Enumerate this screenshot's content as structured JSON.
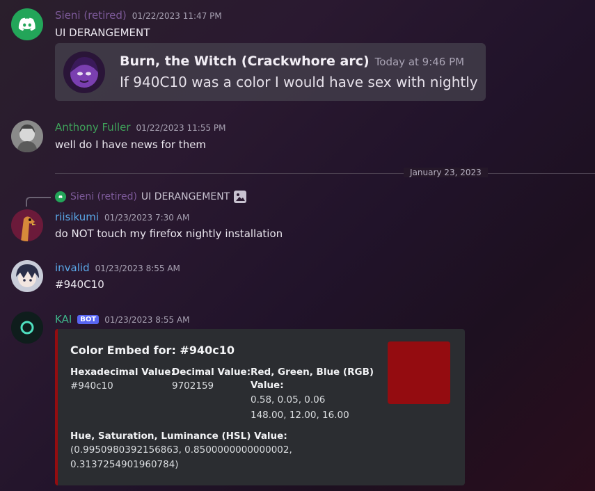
{
  "messages": [
    {
      "author": "Sieni (retired)",
      "author_color": "#7d5a9a",
      "timestamp": "01/22/2023 11:47 PM",
      "text": "UI DERANGEMENT",
      "avatar_icon": "discord-logo-icon",
      "embed": {
        "title": "Burn, the Witch (Crackwhore arc)",
        "time": "Today at 9:46 PM",
        "text": "If 940C10 was a color I would have sex with nightly"
      }
    },
    {
      "author": "Anthony Fuller",
      "author_color": "#3fa15a",
      "timestamp": "01/22/2023 11:55 PM",
      "text": "well do I have news for them"
    },
    {
      "reply_to": {
        "author": "Sieni (retired)",
        "text": "UI DERANGEMENT",
        "attachment_icon": "image-icon"
      },
      "author": "riisikumi",
      "author_color": "#5aa8e8",
      "timestamp": "01/23/2023 7:30 AM",
      "text": "do NOT touch my firefox nightly installation"
    },
    {
      "author": "invalid",
      "author_color": "#5aa8e8",
      "timestamp": "01/23/2023 8:55 AM",
      "text": "#940C10"
    },
    {
      "author": "KAI",
      "author_color": "#3fb58a",
      "bot_tag": "BOT",
      "timestamp": "01/23/2023 8:55 AM",
      "color_embed": {
        "title": "Color Embed for: #940c10",
        "color": "#940c10",
        "fields": [
          {
            "name": "Hexadecimal Value:",
            "value": "#940c10"
          },
          {
            "name": "Decimal Value:",
            "value": "9702159"
          },
          {
            "name_line1": "Red, Green, Blue (RGB)",
            "name_line2": "Value:",
            "value_line1": "0.58, 0.05, 0.06",
            "value_line2": "148.00, 12.00, 16.00"
          },
          {
            "name": "Hue, Saturation, Luminance (HSL) Value:",
            "value_line1": "(0.9950980392156863, 0.8500000000000002,",
            "value_line2": "0.3137254901960784)"
          }
        ]
      }
    }
  ],
  "date_divider": "January 23, 2023"
}
